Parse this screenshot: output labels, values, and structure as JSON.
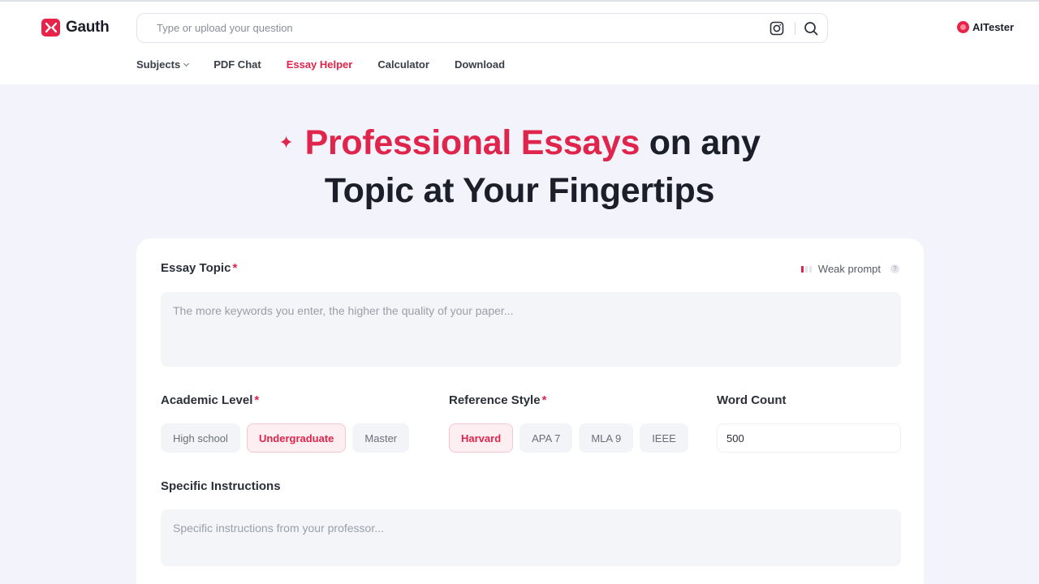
{
  "brand": {
    "name": "Gauth",
    "accent": "#e0254c"
  },
  "search": {
    "placeholder": "Type or upload your question",
    "camera_icon": "camera-icon",
    "search_icon": "search-icon"
  },
  "user": {
    "name": "AITester"
  },
  "nav": {
    "items": [
      {
        "label": "Subjects",
        "has_dropdown": true
      },
      {
        "label": "PDF Chat"
      },
      {
        "label": "Essay Helper",
        "active": true
      },
      {
        "label": "Calculator"
      },
      {
        "label": "Download"
      }
    ]
  },
  "hero": {
    "title_highlight": "Professional Essays",
    "title_rest1": " on any",
    "title_line2": "Topic at Your Fingertips"
  },
  "form": {
    "topic": {
      "label": "Essay Topic",
      "required_mark": "*",
      "strength_text": "Weak prompt",
      "strength_level": 1,
      "strength_max": 3,
      "placeholder": "The more keywords you enter, the higher the quality of your paper..."
    },
    "academic_level": {
      "label": "Academic Level",
      "required_mark": "*",
      "options": [
        "High school",
        "Undergraduate",
        "Master"
      ],
      "selected": "Undergraduate"
    },
    "reference_style": {
      "label": "Reference Style",
      "required_mark": "*",
      "options": [
        "Harvard",
        "APA 7",
        "MLA 9",
        "IEEE"
      ],
      "selected": "Harvard"
    },
    "word_count": {
      "label": "Word Count",
      "value": "500"
    },
    "instructions": {
      "label": "Specific Instructions",
      "placeholder": "Specific instructions from your professor..."
    }
  }
}
